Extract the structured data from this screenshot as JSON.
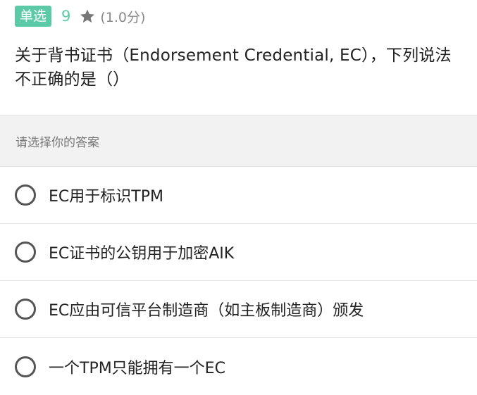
{
  "question": {
    "type_label": "单选",
    "number": "9",
    "score": "(1.0分)",
    "text": "关于背书证书（Endorsement Credential, EC），下列说法不正确的是（）"
  },
  "prompt": "请选择你的答案",
  "options": [
    {
      "label": "EC用于标识TPM"
    },
    {
      "label": "EC证书的公钥用于加密AIK"
    },
    {
      "label": "EC应由可信平台制造商（如主板制造商）颁发"
    },
    {
      "label": "一个TPM只能拥有一个EC"
    }
  ],
  "colors": {
    "accent": "#5cc9a7",
    "star": "#777777"
  },
  "icons": {
    "star": "star-icon",
    "radio": "radio-unchecked-icon"
  }
}
